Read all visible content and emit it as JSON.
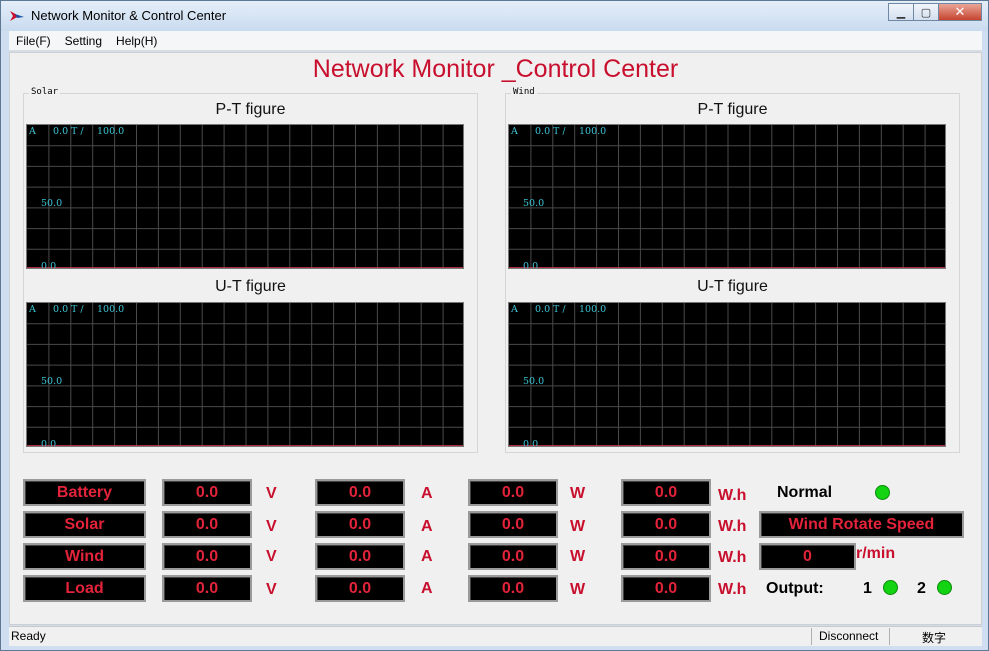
{
  "window": {
    "title": "Network Monitor & Control Center"
  },
  "menu": {
    "items": [
      "File(F)",
      "Setting",
      "Help(H)"
    ]
  },
  "app": {
    "heading": "Network Monitor _Control Center"
  },
  "groups": {
    "solar": {
      "label": "Solar",
      "pt_title": "P-T figure",
      "ut_title": "U-T figure"
    },
    "wind": {
      "label": "Wind",
      "pt_title": "P-T figure",
      "ut_title": "U-T figure"
    }
  },
  "plot_axis": {
    "unit_label": "A",
    "x_start": "0.0",
    "time_label": "T /",
    "x_end": "100.0",
    "y_mid": "50.0",
    "y_min": "0.0"
  },
  "table": {
    "units": {
      "voltage": "V",
      "current": "A",
      "power": "W",
      "energy": "W.h"
    },
    "rows": [
      {
        "name": "Battery",
        "voltage": "0.0",
        "current": "0.0",
        "power": "0.0",
        "energy": "0.0"
      },
      {
        "name": "Solar",
        "voltage": "0.0",
        "current": "0.0",
        "power": "0.0",
        "energy": "0.0"
      },
      {
        "name": "Wind",
        "voltage": "0.0",
        "current": "0.0",
        "power": "0.0",
        "energy": "0.0"
      },
      {
        "name": "Load",
        "voltage": "0.0",
        "current": "0.0",
        "power": "0.0",
        "energy": "0.0"
      }
    ]
  },
  "status": {
    "state": "Normal",
    "wind_speed_label": "Wind Rotate Speed",
    "wind_speed_value": "0",
    "wind_speed_unit": "r/min",
    "output_label": "Output:",
    "output1": "1",
    "output2": "2"
  },
  "statusbar": {
    "left": "Ready",
    "connection": "Disconnect",
    "mode": "数字"
  },
  "colors": {
    "accent": "#c8102e",
    "led": "#13d313",
    "plot_text": "#3cc6d6",
    "plot_line": "#e03a50"
  }
}
